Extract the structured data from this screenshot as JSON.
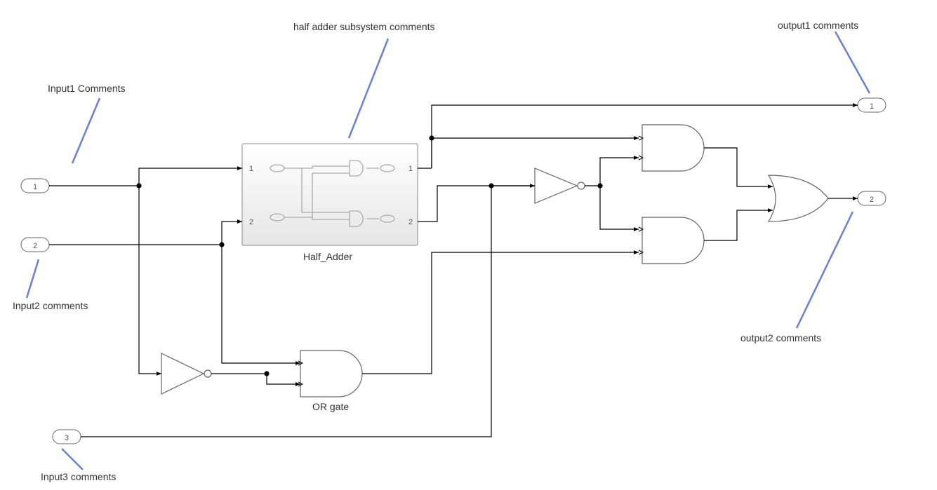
{
  "annotations": {
    "input1": "Input1 Comments",
    "input2": "Input2 comments",
    "input3": "Input3 comments",
    "halfAdder": "half adder subsystem comments",
    "output1": "output1 comments",
    "output2": "output2 comments"
  },
  "ports": {
    "in1": "1",
    "in2": "2",
    "in3": "3",
    "out1": "1",
    "out2": "2"
  },
  "blocks": {
    "halfAdder": {
      "label": "Half_Adder",
      "portIn1": "1",
      "portIn2": "2",
      "portOut1": "1",
      "portOut2": "2"
    },
    "orGate": {
      "label": "OR gate"
    }
  },
  "colors": {
    "annotationLine": "#6a7fd6",
    "blockBorder": "#666666",
    "signal": "#000000",
    "subsystemFillTop": "#ffffff",
    "subsystemFillBottom": "#e2e2e2"
  }
}
